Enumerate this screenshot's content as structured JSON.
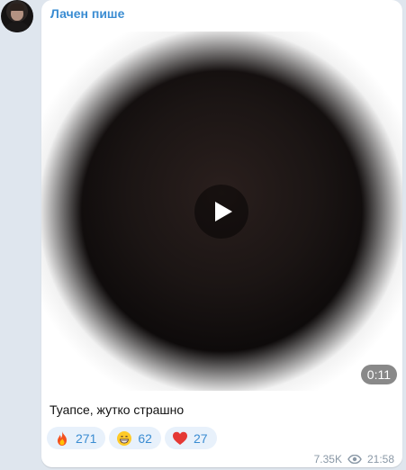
{
  "message": {
    "sender": "Лачен пише",
    "caption": "Туапсе, жутко страшно",
    "video": {
      "duration": "0:11"
    },
    "reactions": [
      {
        "emoji": "fire",
        "count": "271"
      },
      {
        "emoji": "grinning-face",
        "count": "62"
      },
      {
        "emoji": "red-heart",
        "count": "27"
      }
    ],
    "views": "7.35K",
    "time": "21:58"
  },
  "colors": {
    "accent": "#3a8cd2",
    "reaction_bg": "#e8f1fb",
    "chat_bg": "#dfe6ee"
  }
}
